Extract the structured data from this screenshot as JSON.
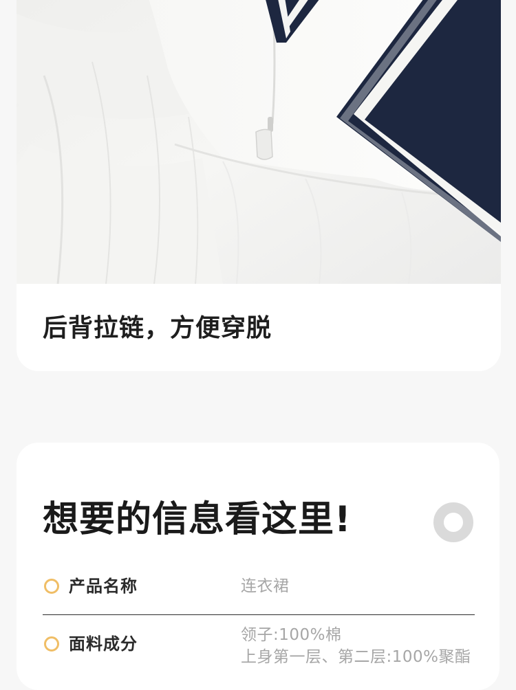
{
  "feature_card": {
    "caption": "后背拉链，方便穿脱"
  },
  "info_card": {
    "title": "想要的信息看这里!",
    "rows": [
      {
        "label": "产品名称",
        "values": [
          "连衣裙"
        ]
      },
      {
        "label": "面料成分",
        "values": [
          "领子:100%棉",
          "上身第一层、第二层:100%聚酯"
        ]
      }
    ]
  },
  "colors": {
    "page_background": "#f7f7f7",
    "card_background": "#ffffff",
    "collar_navy": "#1d2740",
    "bullet_ring": "#f0be66",
    "decor_ring": "#dadada",
    "value_text": "#a6a6a6"
  }
}
